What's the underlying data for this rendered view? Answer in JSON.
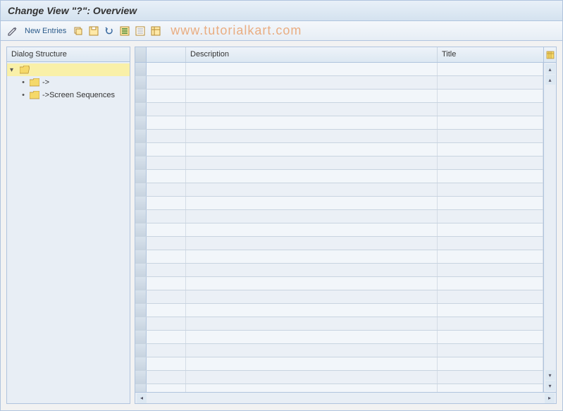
{
  "title": "Change View \"?\": Overview",
  "toolbar": {
    "new_entries_label": "New Entries"
  },
  "watermark": "www.tutorialkart.com",
  "sidebar": {
    "header": "Dialog Structure",
    "root_label": "",
    "items": [
      {
        "label": "->"
      },
      {
        "label": "->Screen Sequences"
      }
    ]
  },
  "grid": {
    "columns": {
      "description": "Description",
      "title": "Title"
    },
    "row_count": 25
  }
}
